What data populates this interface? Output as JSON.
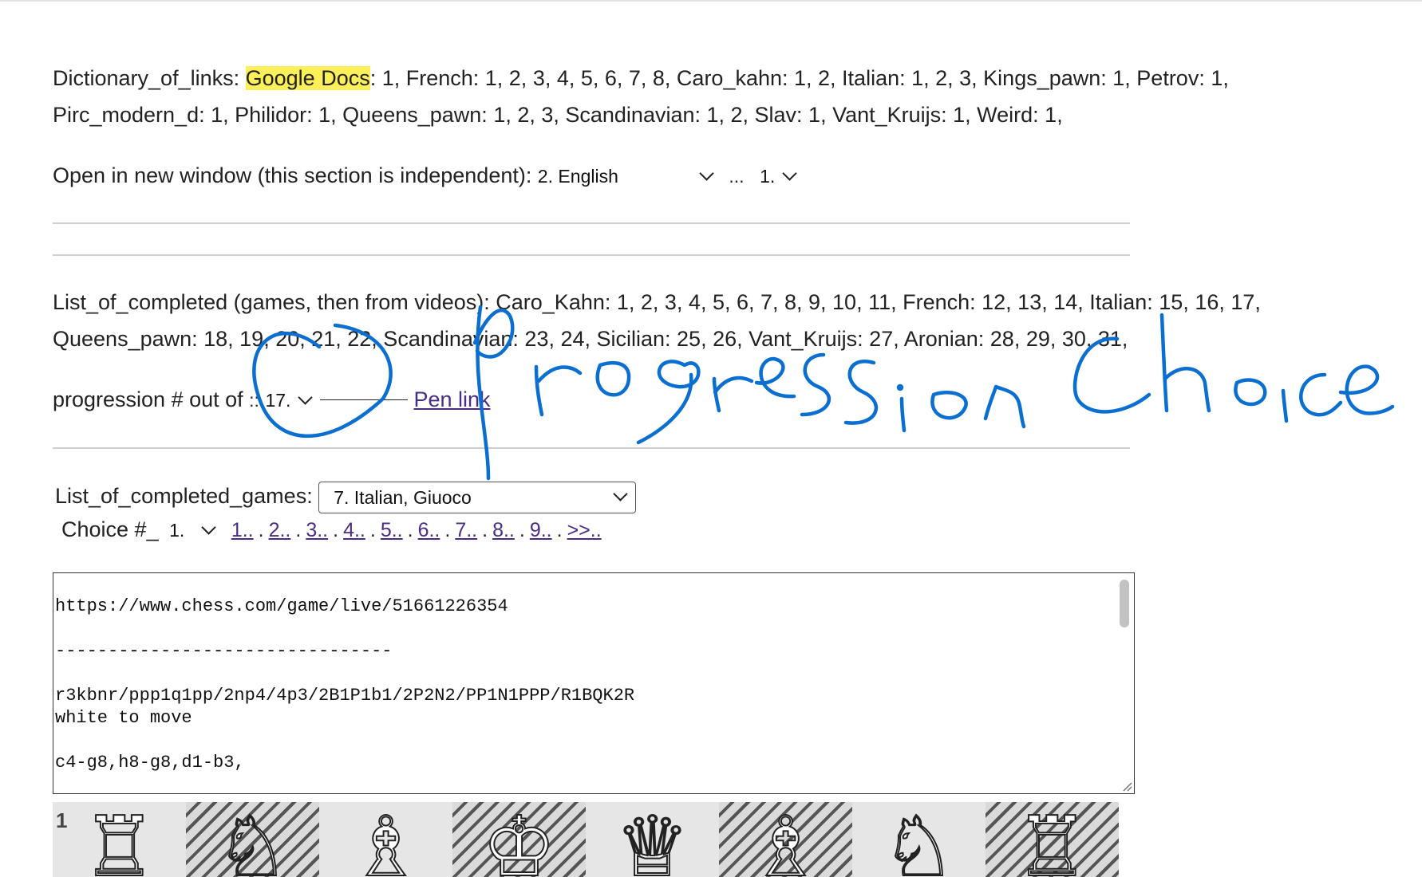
{
  "links_section": {
    "label": "Dictionary_of_links:",
    "highlighted_link": "Google Docs",
    "line1_rest": ": 1, French: 1, 2, 3, 4, 5, 6, 7, 8, Caro_kahn: 1, 2, Italian: 1, 2, 3, Kings_pawn: 1, Petrov: 1,",
    "line2": "Pirc_modern_d: 1, Philidor: 1, Queens_pawn: 1, 2, 3, Scandinavian: 1, 2, Slav: 1, Vant_Kruijs: 1, Weird: 1,"
  },
  "open_window": {
    "label": "Open in new window (this section is independent):",
    "select1_value": "2. English",
    "separator": "...",
    "select2_value": "1."
  },
  "completed": {
    "line1": "List_of_completed (games, then from videos): Caro_Kahn: 1, 2, 3, 4, 5, 6, 7, 8, 9, 10, 11, French: 12, 13, 14, Italian: 15, 16, 17,",
    "line2": "Queens_pawn: 18, 19, 20, 21, 22, Scandinavian: 23, 24, Sicilian: 25, 26, Vant_Kruijs: 27, Aronian: 28, 29, 30, 31,"
  },
  "progression": {
    "label": "progression # out of",
    "separator": "::",
    "select_value": "17.",
    "link_text": "Pen link"
  },
  "games": {
    "label": "List_of_completed_games:",
    "select_value": "7. Italian, Giuoco",
    "choice_label": "Choice #_",
    "choice_value": "1.",
    "nav_links": [
      "1..",
      "2..",
      "3..",
      "4..",
      "5..",
      "6..",
      "7..",
      "8..",
      "9..",
      ">>.."
    ],
    "nav_sep": "."
  },
  "textarea": {
    "url": "https://www.chess.com/game/live/51661226354",
    "divider": "--------------------------------",
    "fen": "r3kbnr/ppp1q1pp/2np4/4p3/2B1P1b1/2P2N2/PP1N1PPP/R1BQK2R",
    "to_move": "white to move",
    "moves": "c4-g8,h8-g8,d1-b3,"
  },
  "board": {
    "rank_label": "1",
    "pieces": [
      "white-rook",
      "white-knight",
      "white-bishop",
      "white-king",
      "white-queen",
      "white-bishop",
      "white-knight",
      "white-rook"
    ],
    "glyphs": [
      "♖",
      "♘",
      "♗",
      "♔",
      "♕",
      "♗",
      "♘",
      "♖"
    ]
  },
  "annotation": {
    "handwritten_text": "Progression Choice",
    "color": "#0a6fd0"
  }
}
